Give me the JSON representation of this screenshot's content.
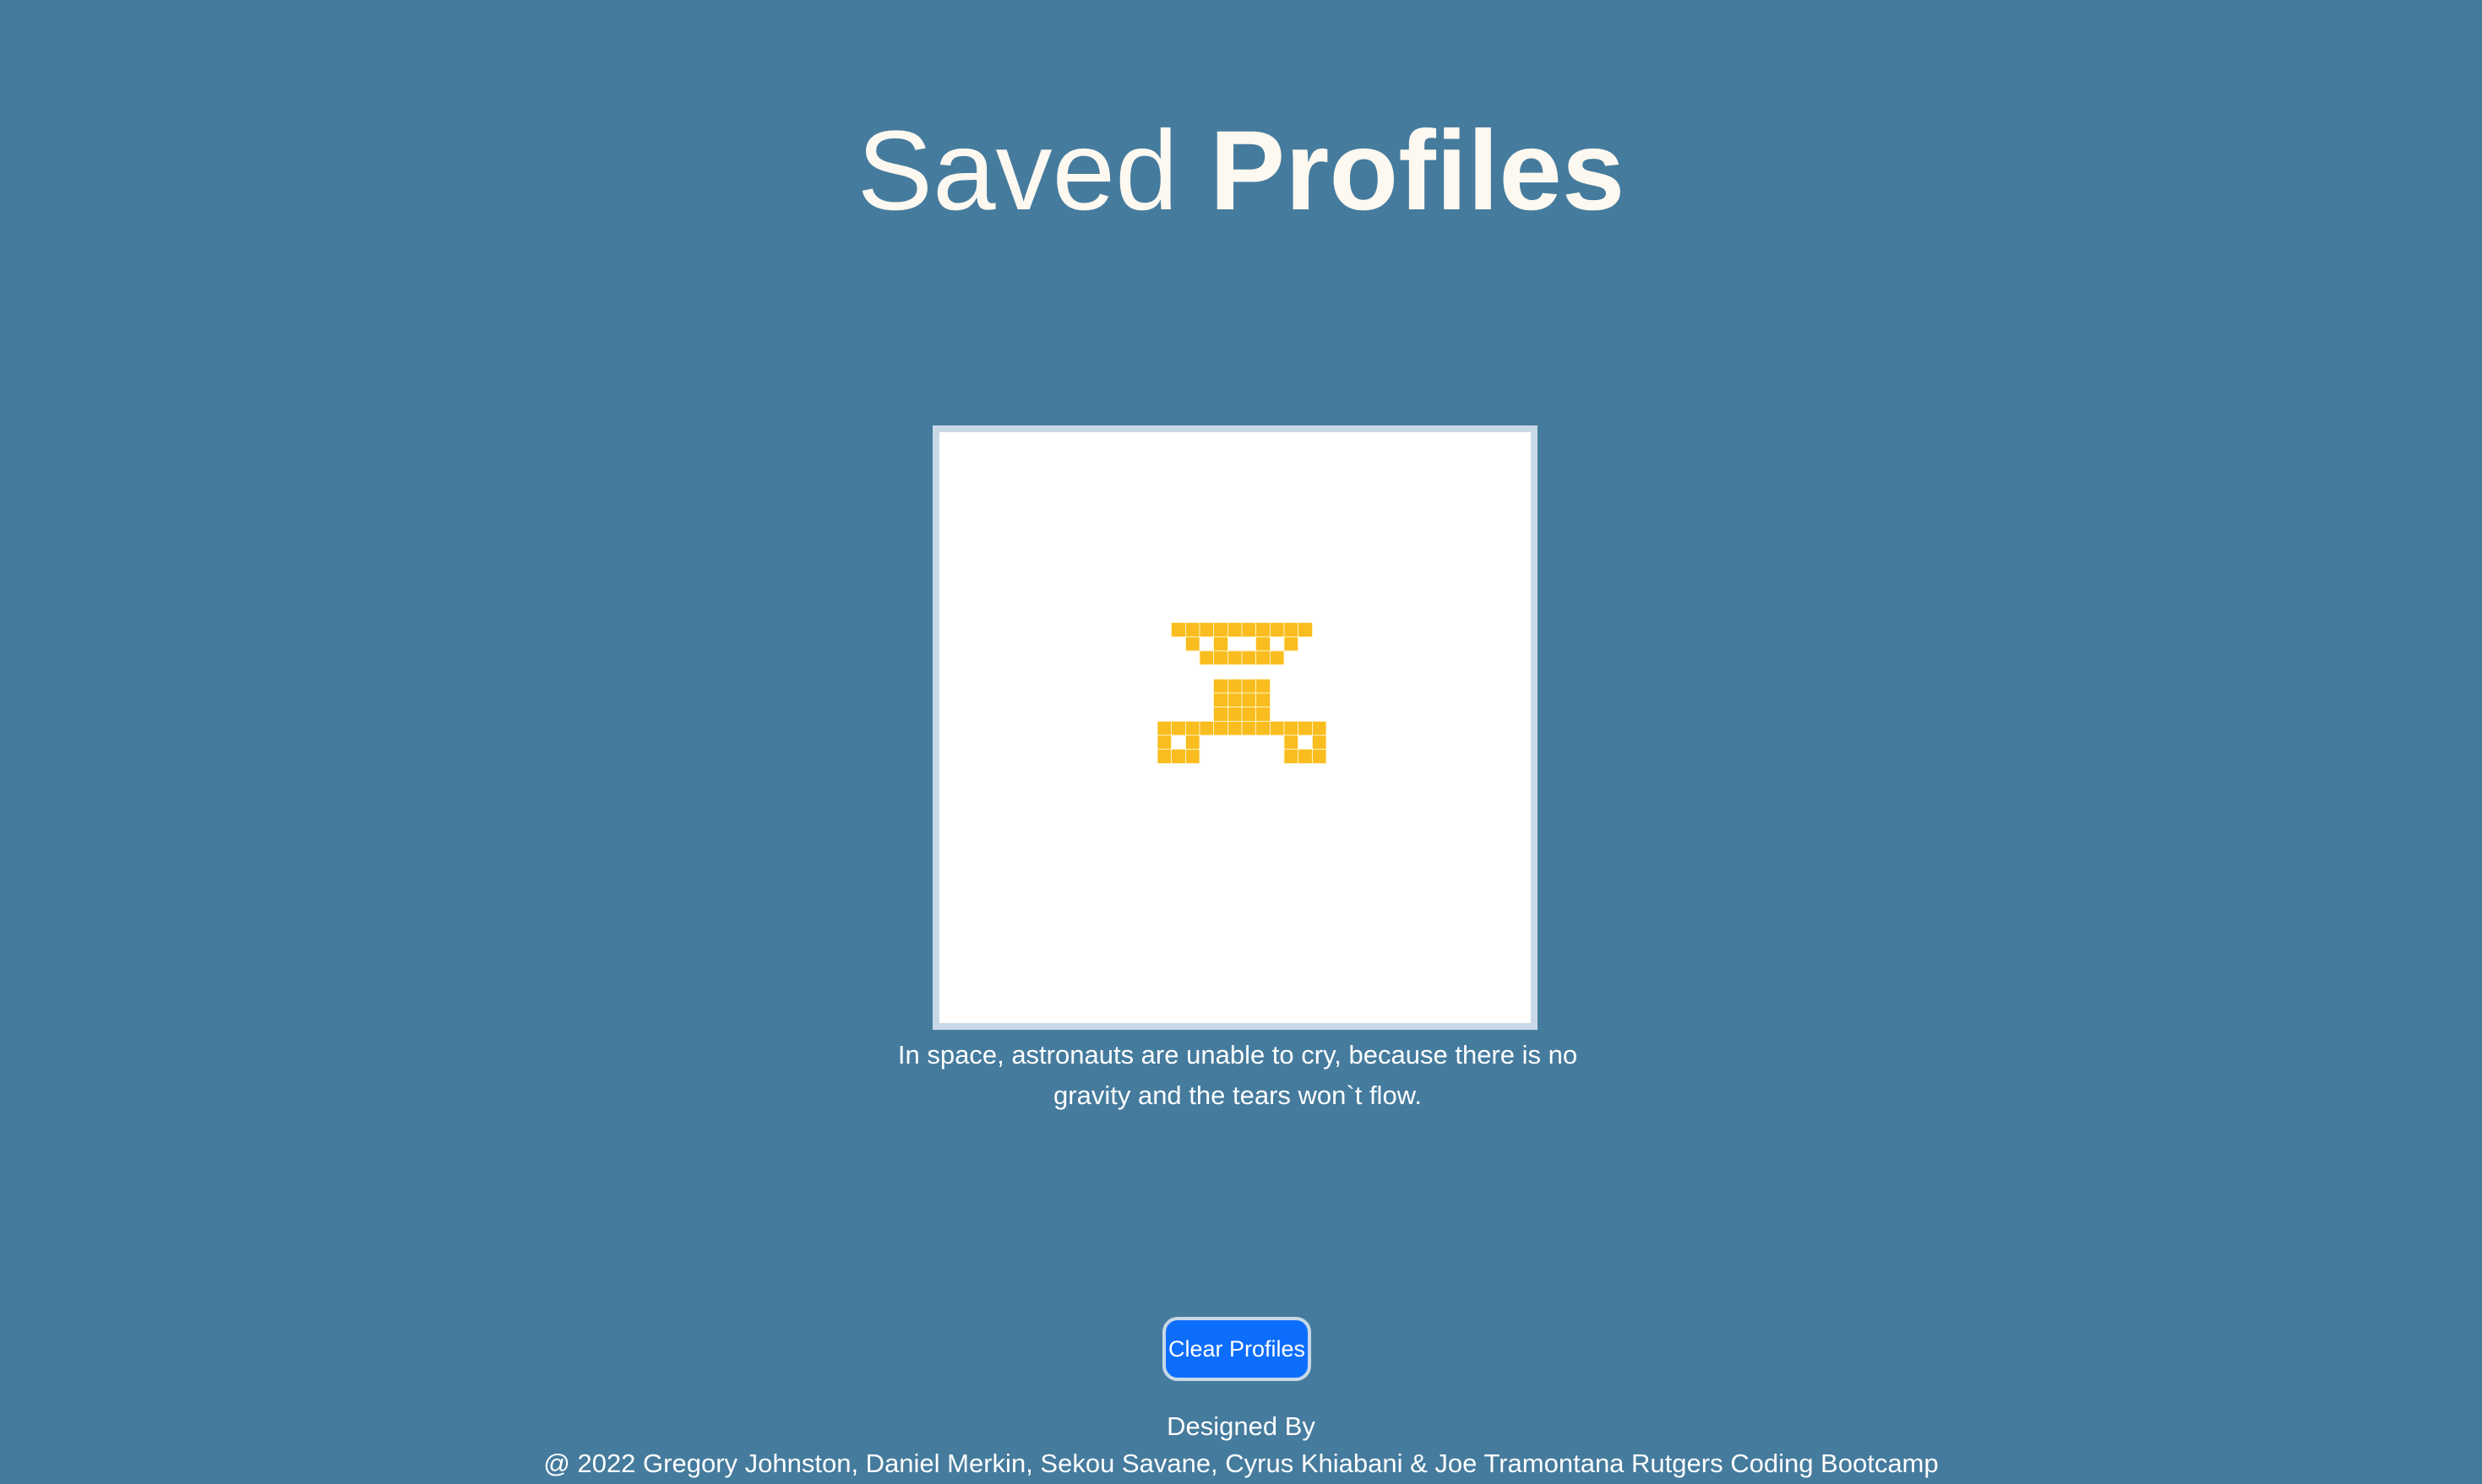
{
  "header": {
    "title_light": "Saved",
    "title_bold": "Profiles"
  },
  "profile_card": {
    "avatar_icon": "pixel-identicon",
    "avatar_color": "#f9bd1f",
    "caption": "In space, astronauts are unable to cry, because there is no gravity and the tears won`t flow."
  },
  "actions": {
    "clear_label": "Clear Profiles"
  },
  "footer": {
    "designed_by": "Designed By",
    "credits": "@ 2022 Gregory Johnston, Daniel Merkin, Sekou Savane, Cyrus Khiabani & Joe Tramontana Rutgers Coding Bootcamp"
  },
  "colors": {
    "background": "#457b9d",
    "button": "#0d6efd",
    "card_border": "#c9d8e6"
  }
}
